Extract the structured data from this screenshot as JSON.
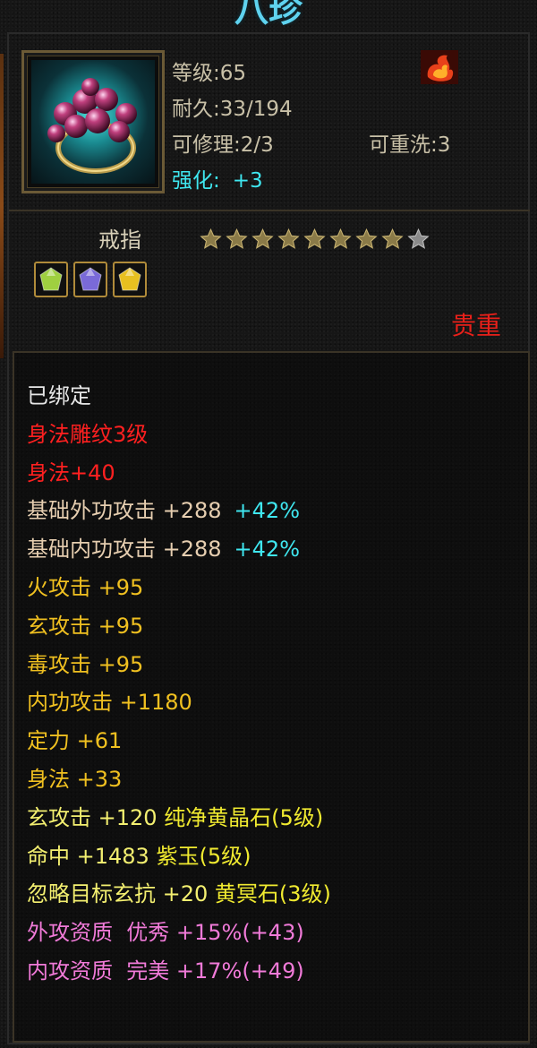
{
  "title": "八珍",
  "item": {
    "level_label": "等级:",
    "level": "65",
    "durability_label": "耐久:",
    "durability": "33/194",
    "repair_label": "可修理:",
    "repair": "2/3",
    "rewash_label": "可重洗:",
    "rewash": "3",
    "strengthen_label": "强化:",
    "strengthen": "+3",
    "type": "戒指",
    "rarity": "贵重",
    "stars_filled": 8,
    "stars_total": 9,
    "icon": "ring-icon",
    "element_icon": "fire-element-icon"
  },
  "gems": [
    {
      "name": "green-gem-icon",
      "color": "#9fd040"
    },
    {
      "name": "purple-gem-icon",
      "color": "#7a6ad8"
    },
    {
      "name": "yellow-gem-icon",
      "color": "#e8c020"
    }
  ],
  "attributes": [
    {
      "text": "已绑定",
      "color": "white"
    },
    {
      "text": "身法雕纹3级",
      "color": "red"
    },
    {
      "text": "身法+40",
      "color": "red"
    },
    {
      "text": "基础外功攻击 +288",
      "extra": "+42%",
      "color": "beige"
    },
    {
      "text": "基础内功攻击 +288",
      "extra": "+42%",
      "color": "beige"
    },
    {
      "text": "火攻击 +95",
      "color": "yellow"
    },
    {
      "text": "玄攻击 +95",
      "color": "yellow"
    },
    {
      "text": "毒攻击 +95",
      "color": "yellow"
    },
    {
      "text": "内功攻击 +1180",
      "color": "yellow"
    },
    {
      "text": "定力 +61",
      "color": "yellow"
    },
    {
      "text": "身法 +33",
      "color": "yellow"
    },
    {
      "text": "玄攻击 +120 ",
      "extra": "纯净黄晶石(5级)",
      "color": "lightyellow"
    },
    {
      "text": "命中 +1483 ",
      "extra": "紫玉(5级)",
      "color": "lightyellow"
    },
    {
      "text": "忽略目标玄抗 +20 ",
      "extra": "黄冥石(3级)",
      "color": "lightyellow"
    },
    {
      "text": "外攻资质  优秀 +15%(+43)",
      "color": "pink"
    },
    {
      "text": "内攻资质  完美 +17%(+49)",
      "color": "pink"
    }
  ],
  "colors": {
    "cyan": "#3fe7f0",
    "red": "#ff2020",
    "gold": "#f0c020",
    "pink": "#f07ad8"
  }
}
